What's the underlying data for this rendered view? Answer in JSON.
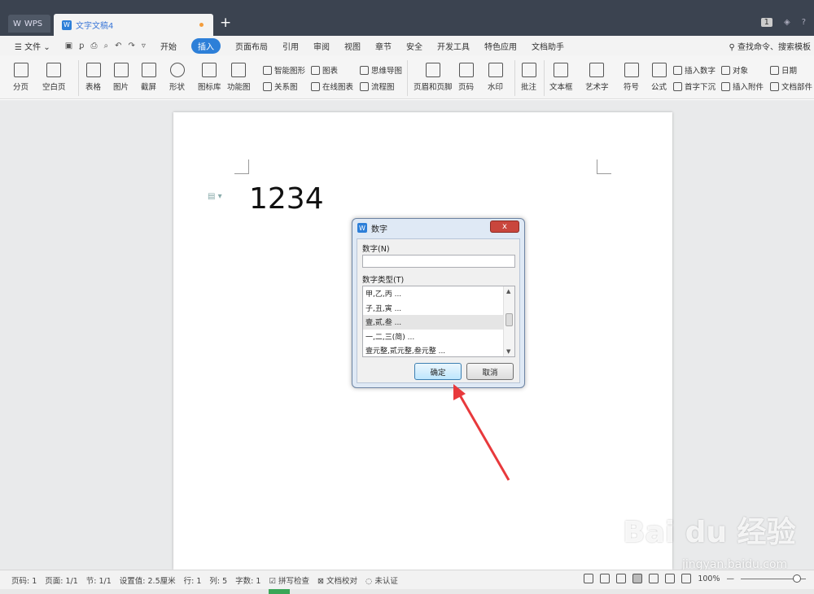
{
  "titlebar": {
    "app_tab": "WPS",
    "doc_tab": "文字文稿4",
    "page_indicator": "1"
  },
  "menubar": {
    "file": "文件",
    "items": [
      "开始",
      "插入",
      "页面布局",
      "引用",
      "审阅",
      "视图",
      "章节",
      "安全",
      "开发工具",
      "特色应用",
      "文档助手"
    ],
    "active": "插入",
    "search": "查找命令、搜索模板"
  },
  "ribbon": {
    "page_break": "分页",
    "blank_page": "空白页",
    "table": "表格",
    "picture": "图片",
    "screenshot": "截屏",
    "shape": "形状",
    "icon_lib": "图标库",
    "function_chart": "功能图",
    "smart_shape": "智能图形",
    "chart": "图表",
    "mind_map": "思维导图",
    "relation_chart": "关系图",
    "online_chart": "在线图表",
    "flowchart": "流程图",
    "header_footer": "页眉和页脚",
    "page_number": "页码",
    "watermark": "水印",
    "comment": "批注",
    "textbox": "文本框",
    "wordart": "艺术字",
    "symbol": "符号",
    "formula": "公式",
    "insert_number": "插入数字",
    "drop_cap": "首字下沉",
    "object": "对象",
    "attachment": "插入附件",
    "date": "日期",
    "doc_parts": "文档部件"
  },
  "document": {
    "text": "1234"
  },
  "dialog": {
    "title": "数字",
    "close": "x",
    "number_label": "数字(N)",
    "number_value": "",
    "type_label": "数字类型(T)",
    "types": [
      "甲,乙,丙 ...",
      "子,丑,寅 ...",
      "壹,贰,叁 ...",
      "一,二,三(简) ...",
      "壹元整,贰元整,叁元整 ..."
    ],
    "selected_index": 2,
    "ok": "确定",
    "cancel": "取消"
  },
  "statusbar": {
    "page_num": "页码: 1",
    "pages": "页面: 1/1",
    "section": "节: 1/1",
    "setting": "设置值: 2.5厘米",
    "row": "行: 1",
    "col": "列: 5",
    "word_count": "字数: 1",
    "spell_check": "拼写检查",
    "doc_proof": "文档校对",
    "uncertified": "未认证",
    "zoom": "100%",
    "zoom_level": 0.8
  },
  "watermark": {
    "brand": "Bai du 经验",
    "url": "jingyan.baidu.com"
  }
}
